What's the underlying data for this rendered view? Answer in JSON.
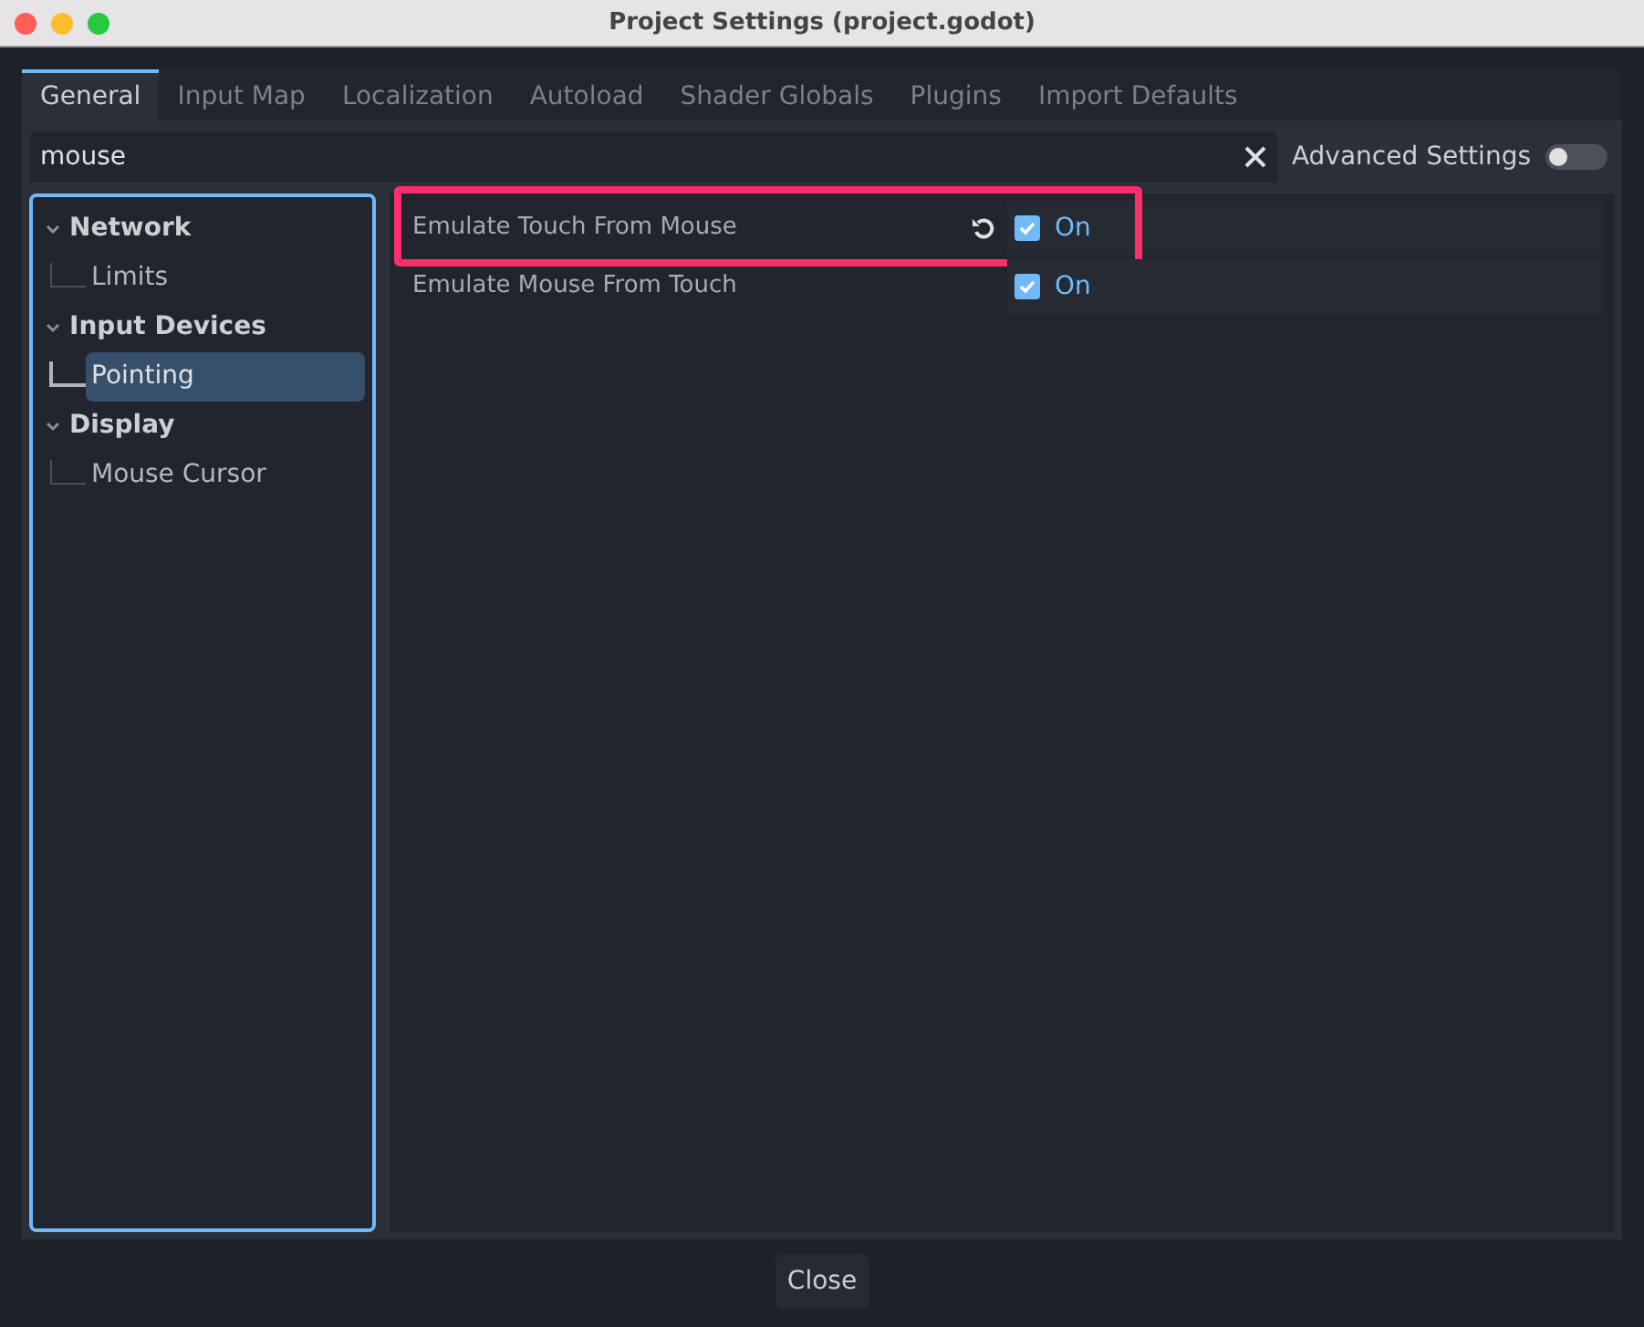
{
  "window": {
    "title": "Project Settings (project.godot)"
  },
  "tabs": [
    {
      "label": "General",
      "selected": true
    },
    {
      "label": "Input Map",
      "selected": false
    },
    {
      "label": "Localization",
      "selected": false
    },
    {
      "label": "Autoload",
      "selected": false
    },
    {
      "label": "Shader Globals",
      "selected": false
    },
    {
      "label": "Plugins",
      "selected": false
    },
    {
      "label": "Import Defaults",
      "selected": false
    }
  ],
  "search": {
    "value": "mouse"
  },
  "advanced_settings": {
    "label": "Advanced Settings",
    "on": false
  },
  "sidebar": {
    "items": [
      {
        "label": "Network",
        "expanded": true,
        "children": [
          {
            "label": "Limits",
            "selected": false
          }
        ]
      },
      {
        "label": "Input Devices",
        "expanded": true,
        "children": [
          {
            "label": "Pointing",
            "selected": true
          }
        ]
      },
      {
        "label": "Display",
        "expanded": true,
        "children": [
          {
            "label": "Mouse Cursor",
            "selected": false
          }
        ]
      }
    ]
  },
  "properties": [
    {
      "label": "Emulate Touch From Mouse",
      "revert": true,
      "checked": true,
      "value": "On",
      "highlighted": true
    },
    {
      "label": "Emulate Mouse From Touch",
      "revert": false,
      "checked": true,
      "value": "On",
      "highlighted": false
    }
  ],
  "buttons": [
    {
      "label": "Close"
    }
  ]
}
